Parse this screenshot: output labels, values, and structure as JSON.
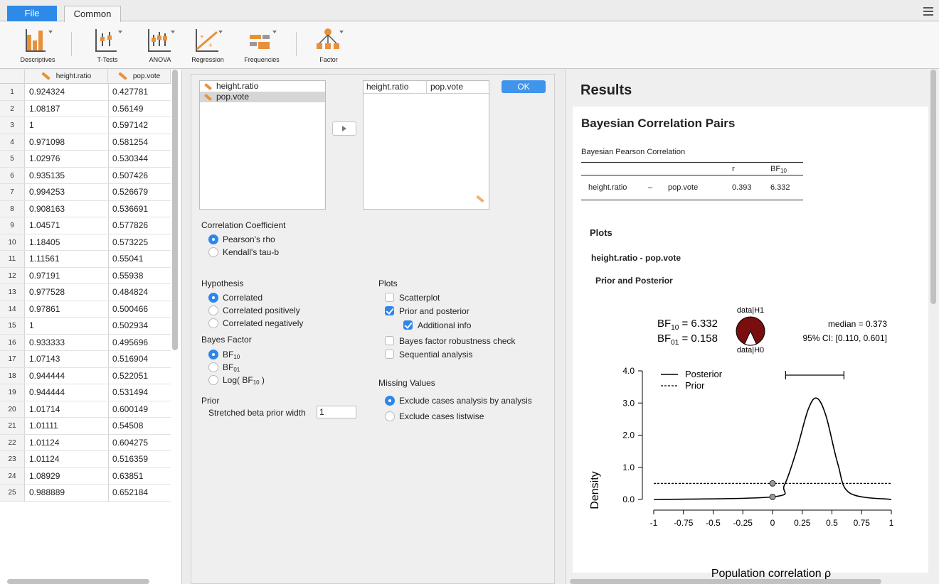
{
  "tabs": {
    "file": "File",
    "common": "Common"
  },
  "ribbon": [
    "Descriptives",
    "T-Tests",
    "ANOVA",
    "Regression",
    "Frequencies",
    "Factor"
  ],
  "grid": {
    "columns": [
      "height.ratio",
      "pop.vote"
    ],
    "rows": [
      [
        "1",
        "0.924324",
        "0.427781"
      ],
      [
        "2",
        "1.08187",
        "0.56149"
      ],
      [
        "3",
        "1",
        "0.597142"
      ],
      [
        "4",
        "0.971098",
        "0.581254"
      ],
      [
        "5",
        "1.02976",
        "0.530344"
      ],
      [
        "6",
        "0.935135",
        "0.507426"
      ],
      [
        "7",
        "0.994253",
        "0.526679"
      ],
      [
        "8",
        "0.908163",
        "0.536691"
      ],
      [
        "9",
        "1.04571",
        "0.577826"
      ],
      [
        "10",
        "1.18405",
        "0.573225"
      ],
      [
        "11",
        "1.11561",
        "0.55041"
      ],
      [
        "12",
        "0.97191",
        "0.55938"
      ],
      [
        "13",
        "0.977528",
        "0.484824"
      ],
      [
        "14",
        "0.97861",
        "0.500466"
      ],
      [
        "15",
        "1",
        "0.502934"
      ],
      [
        "16",
        "0.933333",
        "0.495696"
      ],
      [
        "17",
        "1.07143",
        "0.516904"
      ],
      [
        "18",
        "0.944444",
        "0.522051"
      ],
      [
        "19",
        "0.944444",
        "0.531494"
      ],
      [
        "20",
        "1.01714",
        "0.600149"
      ],
      [
        "21",
        "1.01111",
        "0.54508"
      ],
      [
        "22",
        "1.01124",
        "0.604275"
      ],
      [
        "23",
        "1.01124",
        "0.516359"
      ],
      [
        "24",
        "1.08929",
        "0.63851"
      ],
      [
        "25",
        "0.988889",
        "0.652184"
      ]
    ]
  },
  "options": {
    "source_vars": [
      "height.ratio",
      "pop.vote"
    ],
    "target_vars": [
      "height.ratio",
      "pop.vote"
    ],
    "ok": "OK",
    "coef_title": "Correlation Coefficient",
    "pearson": "Pearson's rho",
    "kendall": "Kendall's tau-b",
    "hyp_title": "Hypothesis",
    "correlated": "Correlated",
    "corr_pos": "Correlated positively",
    "corr_neg": "Correlated negatively",
    "bf_title": "Bayes Factor",
    "bf10": "BF",
    "bf10_sub": "10",
    "bf01": "BF",
    "bf01_sub": "01",
    "logbf_pre": "Log( BF",
    "logbf_sub": "10",
    "logbf_post": " )",
    "prior_title": "Prior",
    "prior_label": "Stretched beta prior width",
    "prior_value": "1",
    "plots_title": "Plots",
    "scatter": "Scatterplot",
    "prior_post": "Prior and posterior",
    "add_info": "Additional info",
    "robust": "Bayes factor robustness check",
    "sequential": "Sequential analysis",
    "missing_title": "Missing Values",
    "excl_analysis": "Exclude cases analysis by analysis",
    "excl_listwise": "Exclude cases listwise"
  },
  "results": {
    "title": "Results",
    "section": "Bayesian Correlation Pairs",
    "table_caption": "Bayesian Pearson Correlation",
    "col_r": "r",
    "col_bf": "BF",
    "col_bf_sub": "10",
    "row_v1": "height.ratio",
    "row_dash": "–",
    "row_v2": "pop.vote",
    "row_r": "0.393",
    "row_bf": "6.332",
    "plots": "Plots",
    "pair": "height.ratio - pop.vote",
    "prior_posterior": "Prior and Posterior"
  },
  "plot": {
    "bf10_label": "BF",
    "bf10_sub": "10",
    "bf10_val": " = 6.332",
    "bf01_label": "BF",
    "bf01_sub": "01",
    "bf01_val": " = 0.158",
    "pie_top": "data|H1",
    "pie_bottom": "data|H0",
    "median": "median = 0.373",
    "ci": "95% CI: [0.110, 0.601]",
    "legend_posterior": "Posterior",
    "legend_prior": "Prior",
    "ylabel": "Density",
    "xlabel": "Population correlation ρ",
    "xticks": [
      "-1",
      "-0.75",
      "-0.5",
      "-0.25",
      "0",
      "0.25",
      "0.5",
      "0.75",
      "1"
    ],
    "yticks": [
      "0.0",
      "1.0",
      "2.0",
      "3.0",
      "4.0"
    ],
    "pie_color": "#7a0e0e"
  },
  "chart_data": {
    "type": "line",
    "xlabel": "Population correlation ρ",
    "ylabel": "Density",
    "xlim": [
      -1,
      1
    ],
    "ylim": [
      0,
      4
    ],
    "series": [
      {
        "name": "Posterior",
        "x": [
          -1,
          0,
          0.1,
          0.2,
          0.3,
          0.373,
          0.45,
          0.55,
          0.65,
          1
        ],
        "y": [
          0,
          0.08,
          0.45,
          1.5,
          2.8,
          3.15,
          2.6,
          1.1,
          0.2,
          0
        ]
      },
      {
        "name": "Prior",
        "x": [
          -1,
          1
        ],
        "y": [
          0.5,
          0.5
        ]
      }
    ],
    "median": 0.373,
    "ci": [
      0.11,
      0.601
    ],
    "bf10": 6.332,
    "bf01": 0.158
  }
}
